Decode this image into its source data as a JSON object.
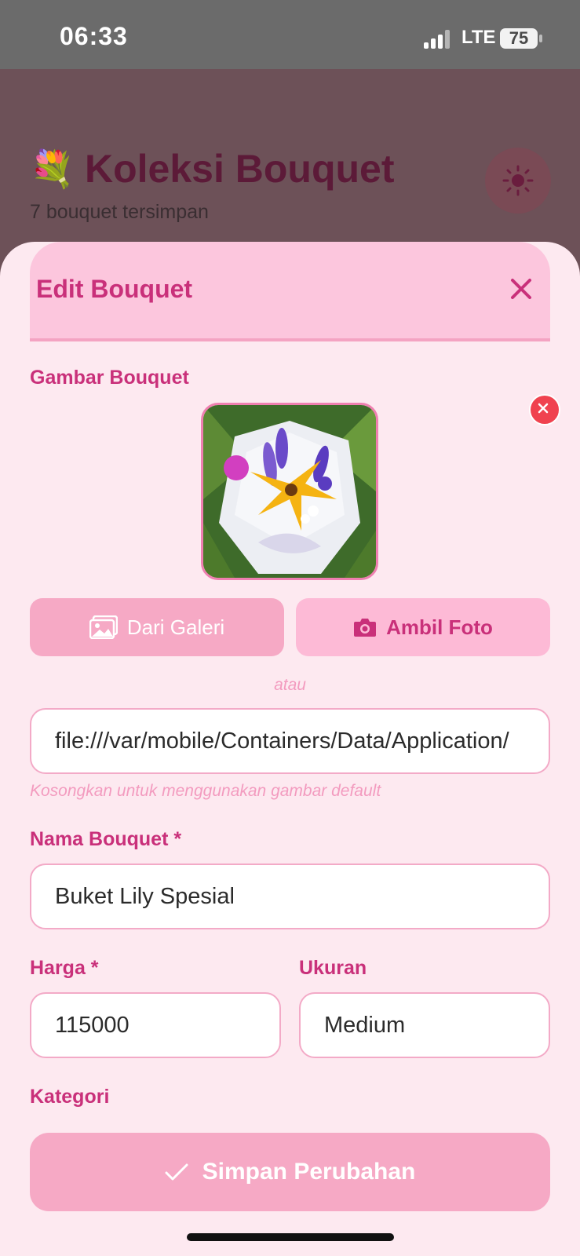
{
  "status_bar": {
    "time": "06:33",
    "network": "LTE",
    "battery": "75"
  },
  "background_page": {
    "icon": "bouquet-emoji",
    "icon_glyph": "💐",
    "title": "Koleksi Bouquet",
    "subtitle": "7 bouquet tersimpan",
    "theme_icon": "sun-icon"
  },
  "modal": {
    "title": "Edit Bouquet",
    "close_icon": "close-icon",
    "image_section": {
      "label": "Gambar Bouquet",
      "gallery_button": "Dari Galeri",
      "camera_button": "Ambil Foto",
      "or_text": "atau",
      "url_value": "file:///var/mobile/Containers/Data/Application/",
      "url_hint": "Kosongkan untuk menggunakan gambar default"
    },
    "name": {
      "label": "Nama Bouquet *",
      "value": "Buket Lily Spesial"
    },
    "price": {
      "label": "Harga *",
      "value": "115000"
    },
    "size": {
      "label": "Ukuran",
      "value": "Medium"
    },
    "category": {
      "label": "Kategori"
    },
    "save_button": "Simpan Perubahan"
  },
  "colors": {
    "accent": "#c9307a",
    "header_bg": "#fcc6dd",
    "button_pink": "#f6a9c5",
    "sheet_bg": "#fde9f0",
    "remove_red": "#f0424f"
  }
}
